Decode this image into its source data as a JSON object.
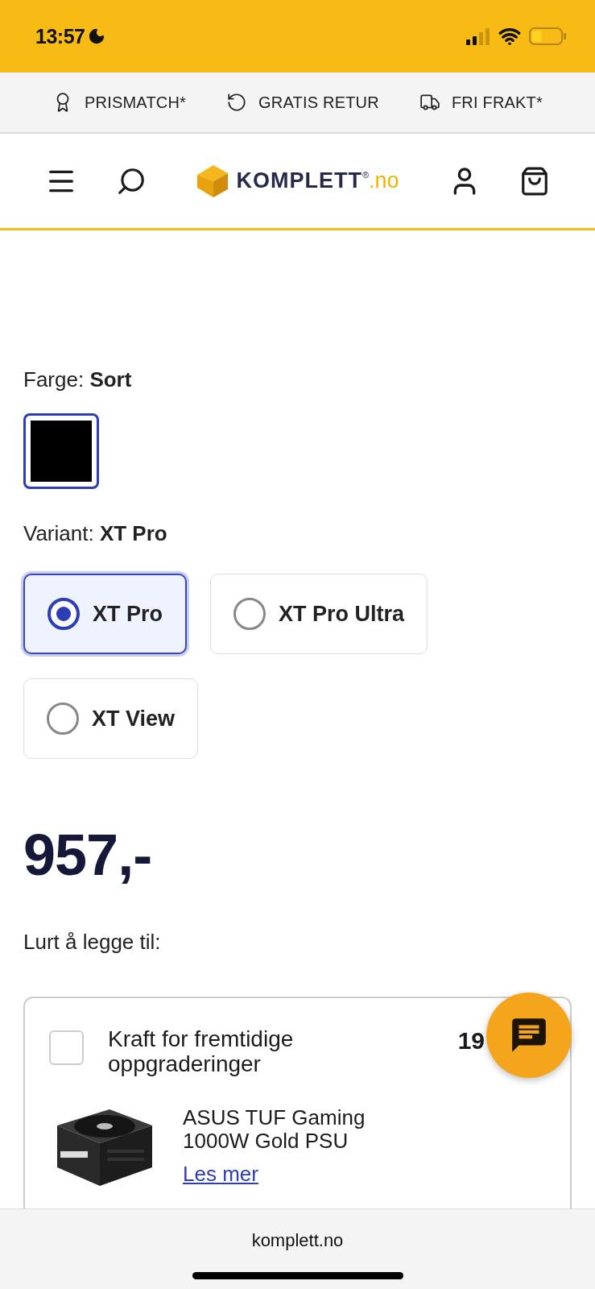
{
  "status_bar": {
    "time": "13:57"
  },
  "benefits": [
    {
      "label": "PRISMATCH*"
    },
    {
      "label": "GRATIS RETUR"
    },
    {
      "label": "FRI FRAKT*"
    }
  ],
  "header": {
    "logo": {
      "name": "KOMPLETT",
      "mark": "®",
      "domain": ".no"
    }
  },
  "color_option": {
    "label": "Farge:",
    "value": "Sort",
    "swatches": [
      {
        "color": "#000000",
        "selected": true
      }
    ]
  },
  "variant": {
    "label": "Variant:",
    "value": "XT Pro",
    "options": [
      {
        "label": "XT Pro",
        "selected": true
      },
      {
        "label": "XT Pro Ultra",
        "selected": false
      },
      {
        "label": "XT View",
        "selected": false
      }
    ]
  },
  "price": "957,-",
  "addons": {
    "title": "Lurt å legge til:",
    "items": [
      {
        "heading": "Kraft for fremtidige oppgraderinger",
        "checked": false,
        "price": "19",
        "product": "ASUS TUF Gaming 1000W Gold PSU",
        "link": "Les mer"
      }
    ]
  },
  "browser_bar": {
    "url": "komplett.no"
  }
}
